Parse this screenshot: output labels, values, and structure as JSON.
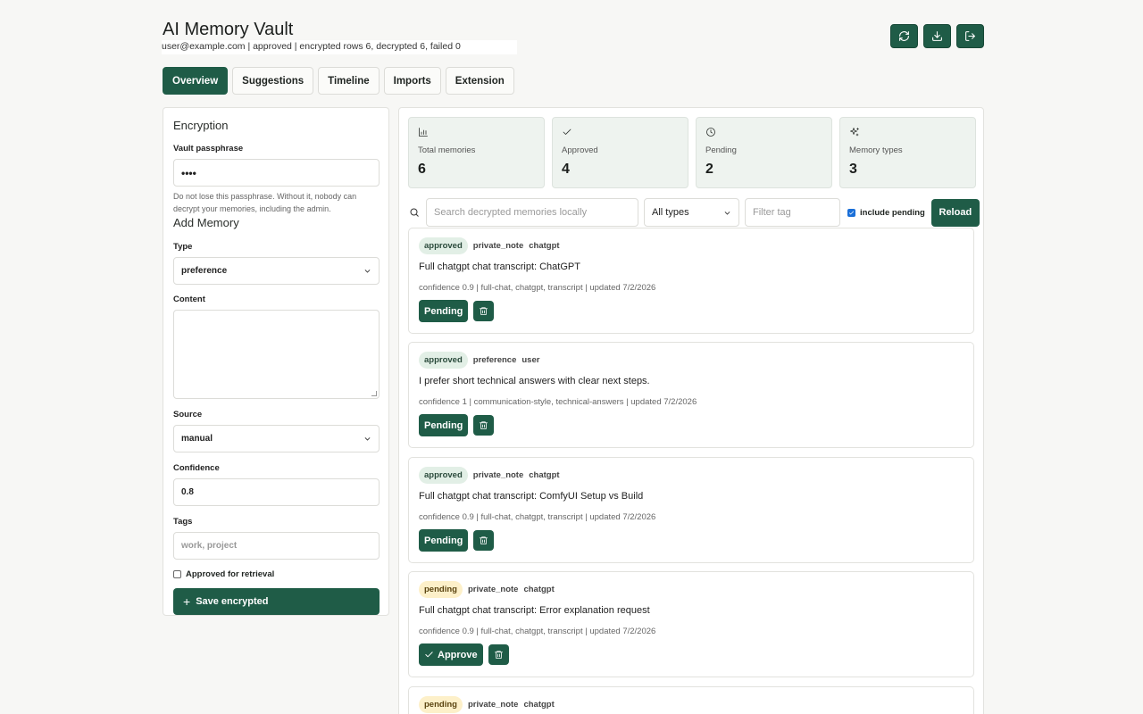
{
  "header": {
    "title": "AI Memory Vault",
    "subtitle": "user@example.com | approved | encrypted rows 6, decrypted 6, failed 0",
    "buttons": [
      {
        "icon": "refresh-icon"
      },
      {
        "icon": "download-icon"
      },
      {
        "icon": "logout-icon"
      }
    ]
  },
  "tabs": [
    {
      "label": "Overview",
      "active": true
    },
    {
      "label": "Suggestions",
      "active": false
    },
    {
      "label": "Timeline",
      "active": false
    },
    {
      "label": "Imports",
      "active": false
    },
    {
      "label": "Extension",
      "active": false
    }
  ],
  "encryption": {
    "title": "Encryption",
    "passphrase_label": "Vault passphrase",
    "passphrase_value": "••••",
    "help": "Do not lose this passphrase. Without it, nobody can decrypt your memories, including the admin."
  },
  "add_memory": {
    "title": "Add Memory",
    "type_label": "Type",
    "type_value": "preference",
    "content_label": "Content",
    "source_label": "Source",
    "source_value": "manual",
    "confidence_label": "Confidence",
    "confidence_value": "0.8",
    "tags_label": "Tags",
    "tags_placeholder": "work, project",
    "approved_label": "Approved for retrieval",
    "save_label": "Save encrypted"
  },
  "stats": [
    {
      "icon": "bar-chart-icon",
      "label": "Total memories",
      "value": "6"
    },
    {
      "icon": "check-icon",
      "label": "Approved",
      "value": "4"
    },
    {
      "icon": "clock-icon",
      "label": "Pending",
      "value": "2"
    },
    {
      "icon": "sparkles-icon",
      "label": "Memory types",
      "value": "3"
    }
  ],
  "filters": {
    "search_placeholder": "Search decrypted memories locally",
    "type_value": "All types",
    "tag_placeholder": "Filter tag",
    "include_pending_label": "include pending",
    "reload_label": "Reload"
  },
  "memories": [
    {
      "status": "approved",
      "type": "private_note",
      "source": "chatgpt",
      "text": "Full chatgpt chat transcript: ChatGPT",
      "meta": "confidence 0.9 | full-chat, chatgpt, transcript | updated 7/2/2026",
      "action": "Pending"
    },
    {
      "status": "approved",
      "type": "preference",
      "source": "user",
      "text": "I prefer short technical answers with clear next steps.",
      "meta": "confidence 1 | communication-style, technical-answers | updated 7/2/2026",
      "action": "Pending"
    },
    {
      "status": "approved",
      "type": "private_note",
      "source": "chatgpt",
      "text": "Full chatgpt chat transcript: ComfyUI Setup vs Build",
      "meta": "confidence 0.9 | full-chat, chatgpt, transcript | updated 7/2/2026",
      "action": "Pending"
    },
    {
      "status": "pending",
      "type": "private_note",
      "source": "chatgpt",
      "text": "Full chatgpt chat transcript: Error explanation request",
      "meta": "confidence 0.9 | full-chat, chatgpt, transcript | updated 7/2/2026",
      "action": "Approve"
    },
    {
      "status": "pending",
      "type": "private_note",
      "source": "chatgpt",
      "text": "",
      "meta": "",
      "action": ""
    }
  ]
}
